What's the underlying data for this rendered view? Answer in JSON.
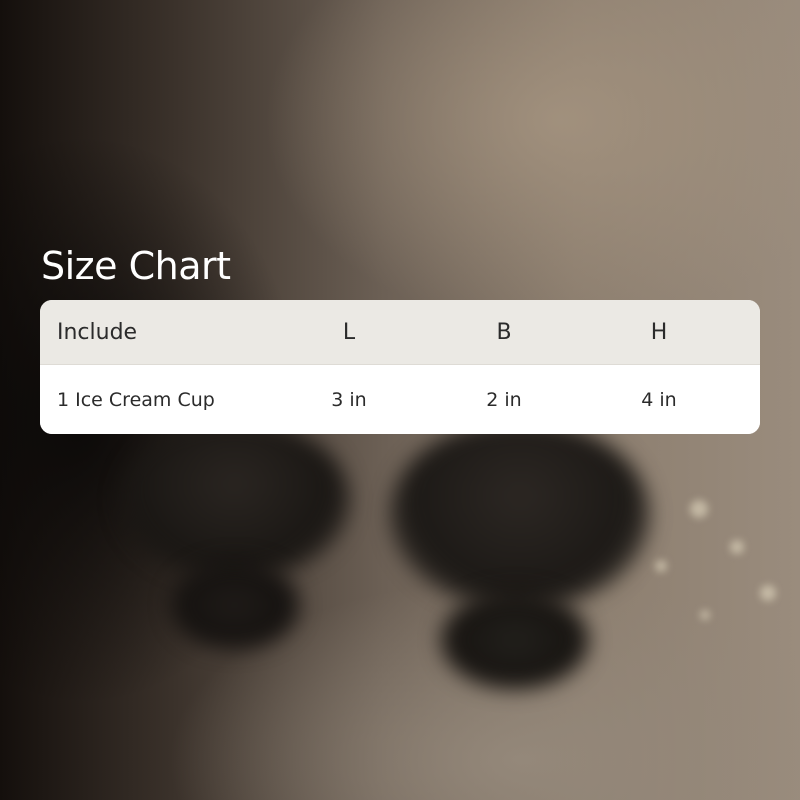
{
  "size_chart": {
    "title": "Size Chart",
    "columns": [
      "Include",
      "L",
      "B",
      "H"
    ],
    "rows": [
      {
        "item": "1 Ice Cream Cup",
        "length": "3 in",
        "breadth": "2 in",
        "height": "4 in"
      }
    ]
  },
  "colors": {
    "header_row_background": "#ebe9e4",
    "body_row_background": "#ffffff",
    "title_text": "#ffffff",
    "table_text": "#2b2b2b"
  }
}
